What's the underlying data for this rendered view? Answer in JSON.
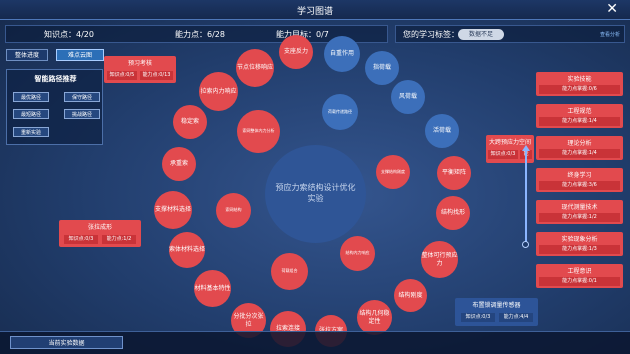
{
  "window": {
    "title": "学习图谱"
  },
  "stats": {
    "knowledge": "知识点：4/20",
    "ability": "能力点：6/28",
    "ability_goal": "能力目标：0/7"
  },
  "tags": {
    "label": "您的学习标签：",
    "value": "数据不足",
    "analysis_link": "查看分析"
  },
  "modes": {
    "overall": "整体进度",
    "hard": "难点云图"
  },
  "path": {
    "title": "智能路径推荐",
    "buttons": [
      "最优路径",
      "保守路径",
      "最短路径",
      "挑战路径",
      "重新实验"
    ]
  },
  "center": {
    "label": "预应力索结构设计优化实验"
  },
  "circles": [
    "支座反力",
    "自重作用",
    "节点位移响应",
    "拉索内力响应",
    "指荷载",
    "风荷载",
    "活荷载",
    "平衡矩阵",
    "结构找形",
    "整体可行预应力",
    "结构刚度",
    "结构几何稳定性",
    "拉索连接",
    "张拉方案",
    "分批分次张拉",
    "材料基本特性",
    "索体材料选择",
    "支撑材料选择",
    "承重索",
    "稳定索",
    "索网结构",
    "索网整体内力分析",
    "荷载传递路径",
    "支撑结构刚度",
    "结构内力响应",
    "荷载组合"
  ],
  "cards": {
    "preview": {
      "title": "预习考核",
      "k": "知识点:0/5",
      "a": "能力点:0/13"
    },
    "tension": {
      "title": "张拉成形",
      "k": "知识点:0/3",
      "a": "能力点:1/2"
    },
    "prestress": {
      "title": "大跨预应力空间",
      "k": "知识点:0/3",
      "a": "能"
    }
  },
  "goals": [
    {
      "title": "实验技能",
      "progress": "能力点掌握:0/6"
    },
    {
      "title": "工程规范",
      "progress": "能力点掌握:1/4"
    },
    {
      "title": "理论分析",
      "progress": "能力点掌握:1/4"
    },
    {
      "title": "终身学习",
      "progress": "能力点掌握:3/6"
    },
    {
      "title": "现代测量技术",
      "progress": "能力点掌握:1/2"
    },
    {
      "title": "实验现象分析",
      "progress": "能力点掌握:1/3"
    },
    {
      "title": "工程意识",
      "progress": "能力点掌握:0/1"
    }
  ],
  "sensor": {
    "title": "布置锁调量传感器",
    "k": "知识点:0/3",
    "a": "能力点:4/4"
  },
  "footer": {
    "button": "当前实验数据"
  }
}
